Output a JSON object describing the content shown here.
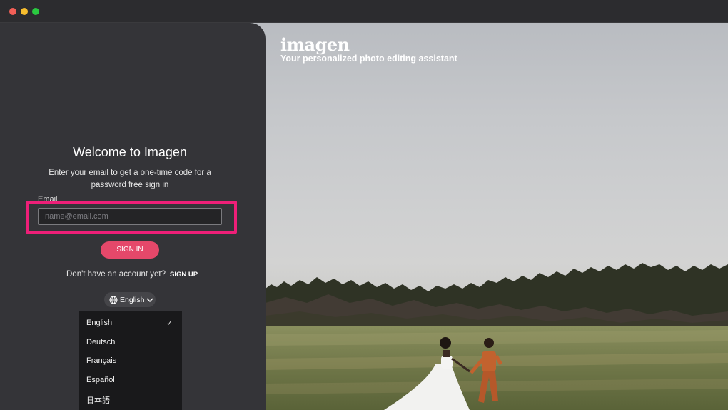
{
  "brand": {
    "logo": "imagen",
    "tagline": "Your personalized photo editing assistant"
  },
  "signin": {
    "title": "Welcome to Imagen",
    "subtitle": "Enter your email to get a one-time code for a password free sign in",
    "email_label": "Email",
    "email_placeholder": "name@email.com",
    "email_value": "",
    "signin_label": "SIGN IN",
    "no_account_text": "Don't have an account yet?",
    "signup_label": "SIGN UP"
  },
  "language": {
    "selected": "English",
    "options": [
      "English",
      "Deutsch",
      "Français",
      "Español",
      "日本語"
    ]
  },
  "icons": {
    "globe": "globe-icon",
    "chevron": "chevron-down-icon",
    "check": "check-icon"
  },
  "colors": {
    "accent": "#e5486a",
    "highlight": "#ee1f78",
    "panel": "#343438"
  }
}
